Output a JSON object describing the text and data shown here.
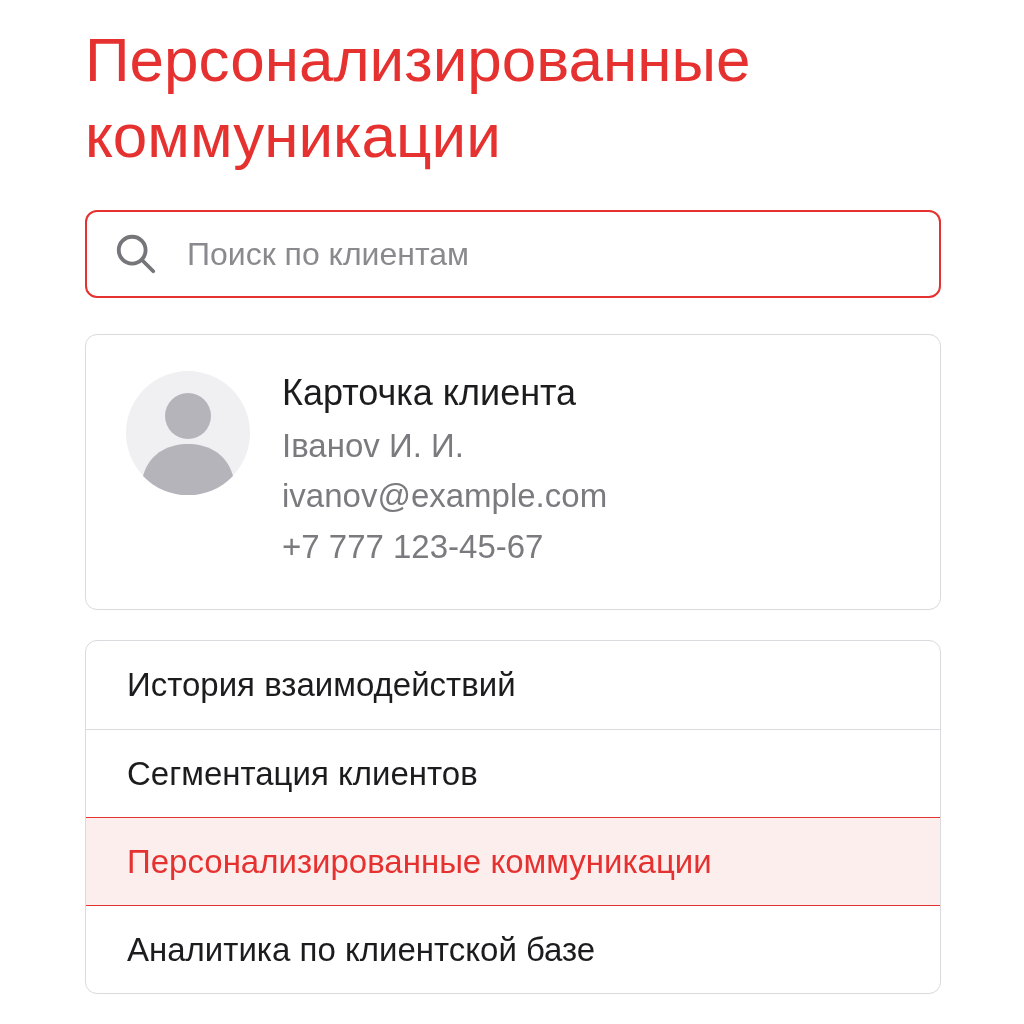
{
  "title": "Персонализированные коммуникации",
  "search": {
    "placeholder": "Поиск по клиентам"
  },
  "client_card": {
    "heading": "Карточка клиента",
    "name": "Iванov И. И.",
    "email": "ivanov@example.com",
    "phone": "+7 777 123-45-67"
  },
  "menu": [
    {
      "label": "История взаимодействий",
      "selected": false
    },
    {
      "label": "Сегментация клиентов",
      "selected": false
    },
    {
      "label": "Персонализированные коммуникации",
      "selected": true
    },
    {
      "label": "Аналитика по клиентской базе",
      "selected": false
    }
  ]
}
